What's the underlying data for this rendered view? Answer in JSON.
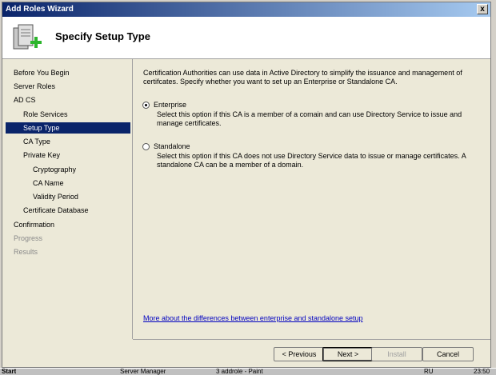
{
  "window": {
    "title": "Add Roles Wizard",
    "close_glyph": "x"
  },
  "header": {
    "title": "Specify Setup Type",
    "icon": "server-add-icon"
  },
  "nav": {
    "items": [
      {
        "label": "Before You Begin",
        "state": "normal"
      },
      {
        "label": "Server Roles",
        "state": "normal"
      },
      {
        "label": "AD CS",
        "state": "normal"
      },
      {
        "label": "Role Services",
        "state": "normal"
      },
      {
        "label": "Setup Type",
        "state": "selected"
      },
      {
        "label": "CA Type",
        "state": "normal"
      },
      {
        "label": "Private Key",
        "state": "normal"
      },
      {
        "label": "Cryptography",
        "state": "normal"
      },
      {
        "label": "CA Name",
        "state": "normal"
      },
      {
        "label": "Validity Period",
        "state": "normal"
      },
      {
        "label": "Certificate Database",
        "state": "normal"
      },
      {
        "label": "Confirmation",
        "state": "normal"
      },
      {
        "label": "Progress",
        "state": "disabled"
      },
      {
        "label": "Results",
        "state": "disabled"
      }
    ]
  },
  "content": {
    "description": "Certification Authorities can use data in Active Directory to simplify the issuance and management of certifcates. Specify whether you want to set up an Enterprise or Standalone CA.",
    "options": [
      {
        "label": "Enterprise",
        "checked": true,
        "description": "Select this option if this CA is a member of a comain and can use Directory Service to issue and manage certificates."
      },
      {
        "label": "Standalone",
        "checked": false,
        "description": "Select this option if this CA does not use Directory Service data to issue or manage certificates. A standalone CA can be a member of a domain."
      }
    ],
    "link": "More about the differences between enterprise and standalone setup"
  },
  "buttons": {
    "previous": "< Previous",
    "next": "Next >",
    "install": "Install",
    "cancel": "Cancel"
  },
  "taskbar": {
    "start": "Start",
    "item1": "Server Manager",
    "item2": "3 addrole - Paint",
    "lang": "RU",
    "clock": "23:50"
  }
}
